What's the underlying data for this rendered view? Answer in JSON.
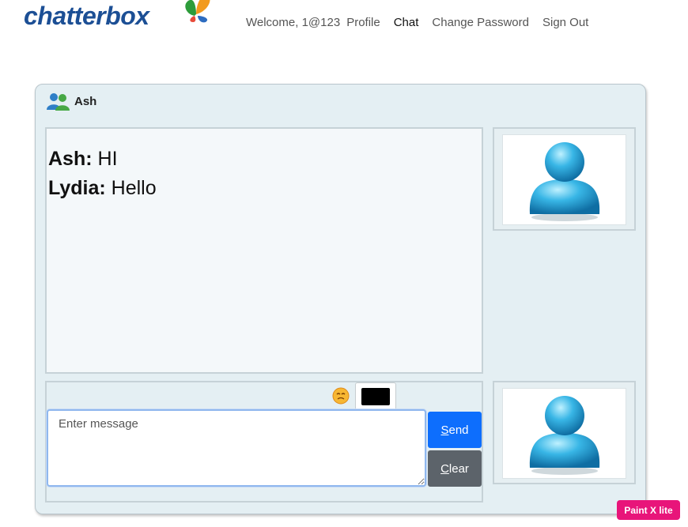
{
  "header": {
    "logo_text": "chatterbox",
    "welcome": "Welcome, 1@123",
    "nav": {
      "profile": "Profile",
      "chat": "Chat",
      "change_password": "Change Password",
      "sign_out": "Sign Out"
    }
  },
  "chat": {
    "partner_name": "Ash",
    "messages": [
      {
        "sender": "Ash:",
        "text": "HI"
      },
      {
        "sender": "Lydia:",
        "text": "Hello"
      }
    ],
    "input_placeholder": "Enter message",
    "text_color": "#000000",
    "send_label_accesskey": "S",
    "send_label_rest": "end",
    "clear_label_accesskey": "C",
    "clear_label_rest": "lear"
  },
  "badge": {
    "label": "Paint X lite"
  },
  "colors": {
    "brand": "#1c4f95",
    "send": "#0d6efd",
    "clear": "#5c636a",
    "panel_bg": "#e4eff3",
    "badge": "#e8157a"
  }
}
